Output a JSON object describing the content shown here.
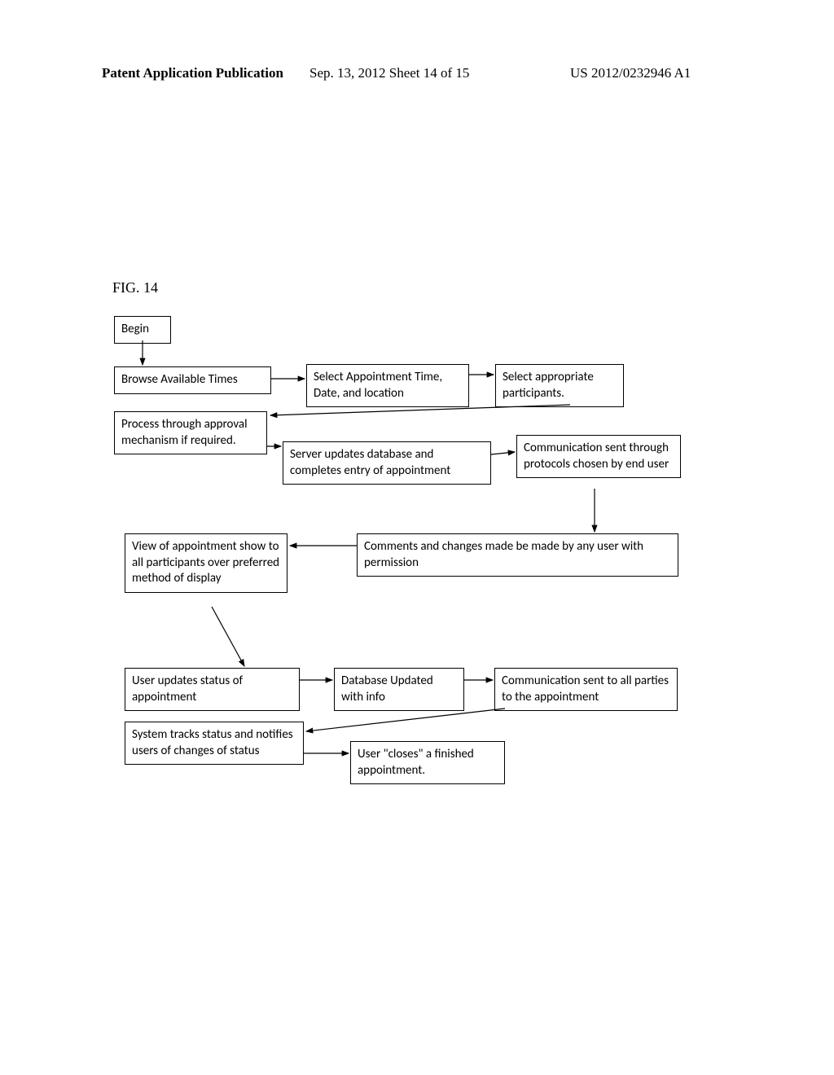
{
  "header": {
    "left": "Patent Application Publication",
    "mid": "Sep. 13, 2012  Sheet 14 of 15",
    "right": "US 2012/0232946 A1"
  },
  "fig_label": "FIG. 14",
  "boxes": {
    "begin": "Begin",
    "browse": "Browse Available Times",
    "select_time": "Select Appointment Time, Date, and location",
    "select_participants": "Select appropriate participants.",
    "approval": "Process through approval mechanism if required.",
    "server_updates": "Server updates database and completes entry of appointment",
    "comm_protocols": "Communication sent through protocols chosen by end user",
    "view_appt": "View of appointment show to all participants over preferred method of display",
    "comments": "Comments and changes made be made by any user with permission",
    "user_updates": "User updates status of appointment",
    "db_updated": "Database Updated with info",
    "comm_all": "Communication sent to all parties to the appointment",
    "system_tracks": "System tracks status and notifies  users of changes of status",
    "user_closes": "User \"closes\" a finished appointment."
  }
}
